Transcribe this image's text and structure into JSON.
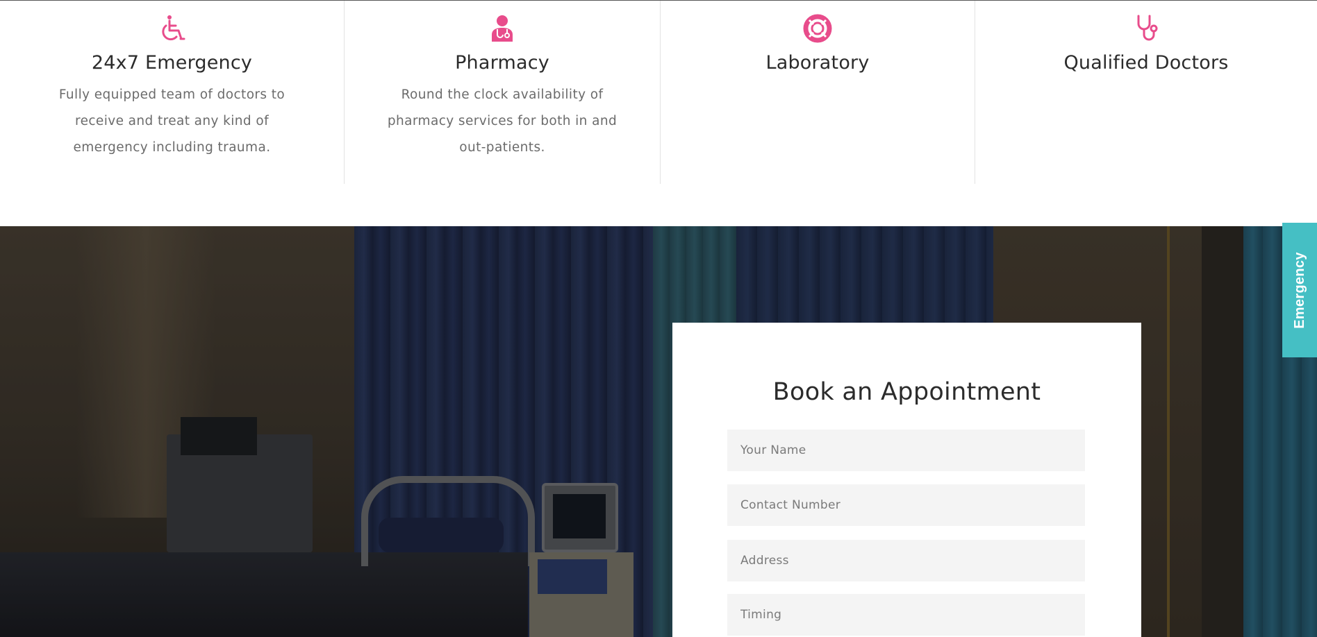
{
  "colors": {
    "accent": "#e84c8b",
    "emergency_tab": "#45bfc4",
    "title_text": "#2b2b2b",
    "body_text": "#6b6b6b",
    "field_bg": "#f4f4f4"
  },
  "features": [
    {
      "icon": "wheelchair-icon",
      "title": "24x7 Emergency",
      "description": "Fully equipped team of doctors to receive and treat any kind of emergency including trauma."
    },
    {
      "icon": "doctor-icon",
      "title": "Pharmacy",
      "description": "Round the clock availability of pharmacy services for both in and out-patients."
    },
    {
      "icon": "lifebuoy-icon",
      "title": "Laboratory",
      "description": ""
    },
    {
      "icon": "stethoscope-icon",
      "title": "Qualified Doctors",
      "description": ""
    }
  ],
  "appointment": {
    "title": "Book an Appointment",
    "fields": {
      "name_placeholder": "Your Name",
      "contact_placeholder": "Contact Number",
      "address_placeholder": "Address",
      "timing_placeholder": "Timing"
    }
  },
  "emergency_tab": {
    "label": "Emergency"
  }
}
